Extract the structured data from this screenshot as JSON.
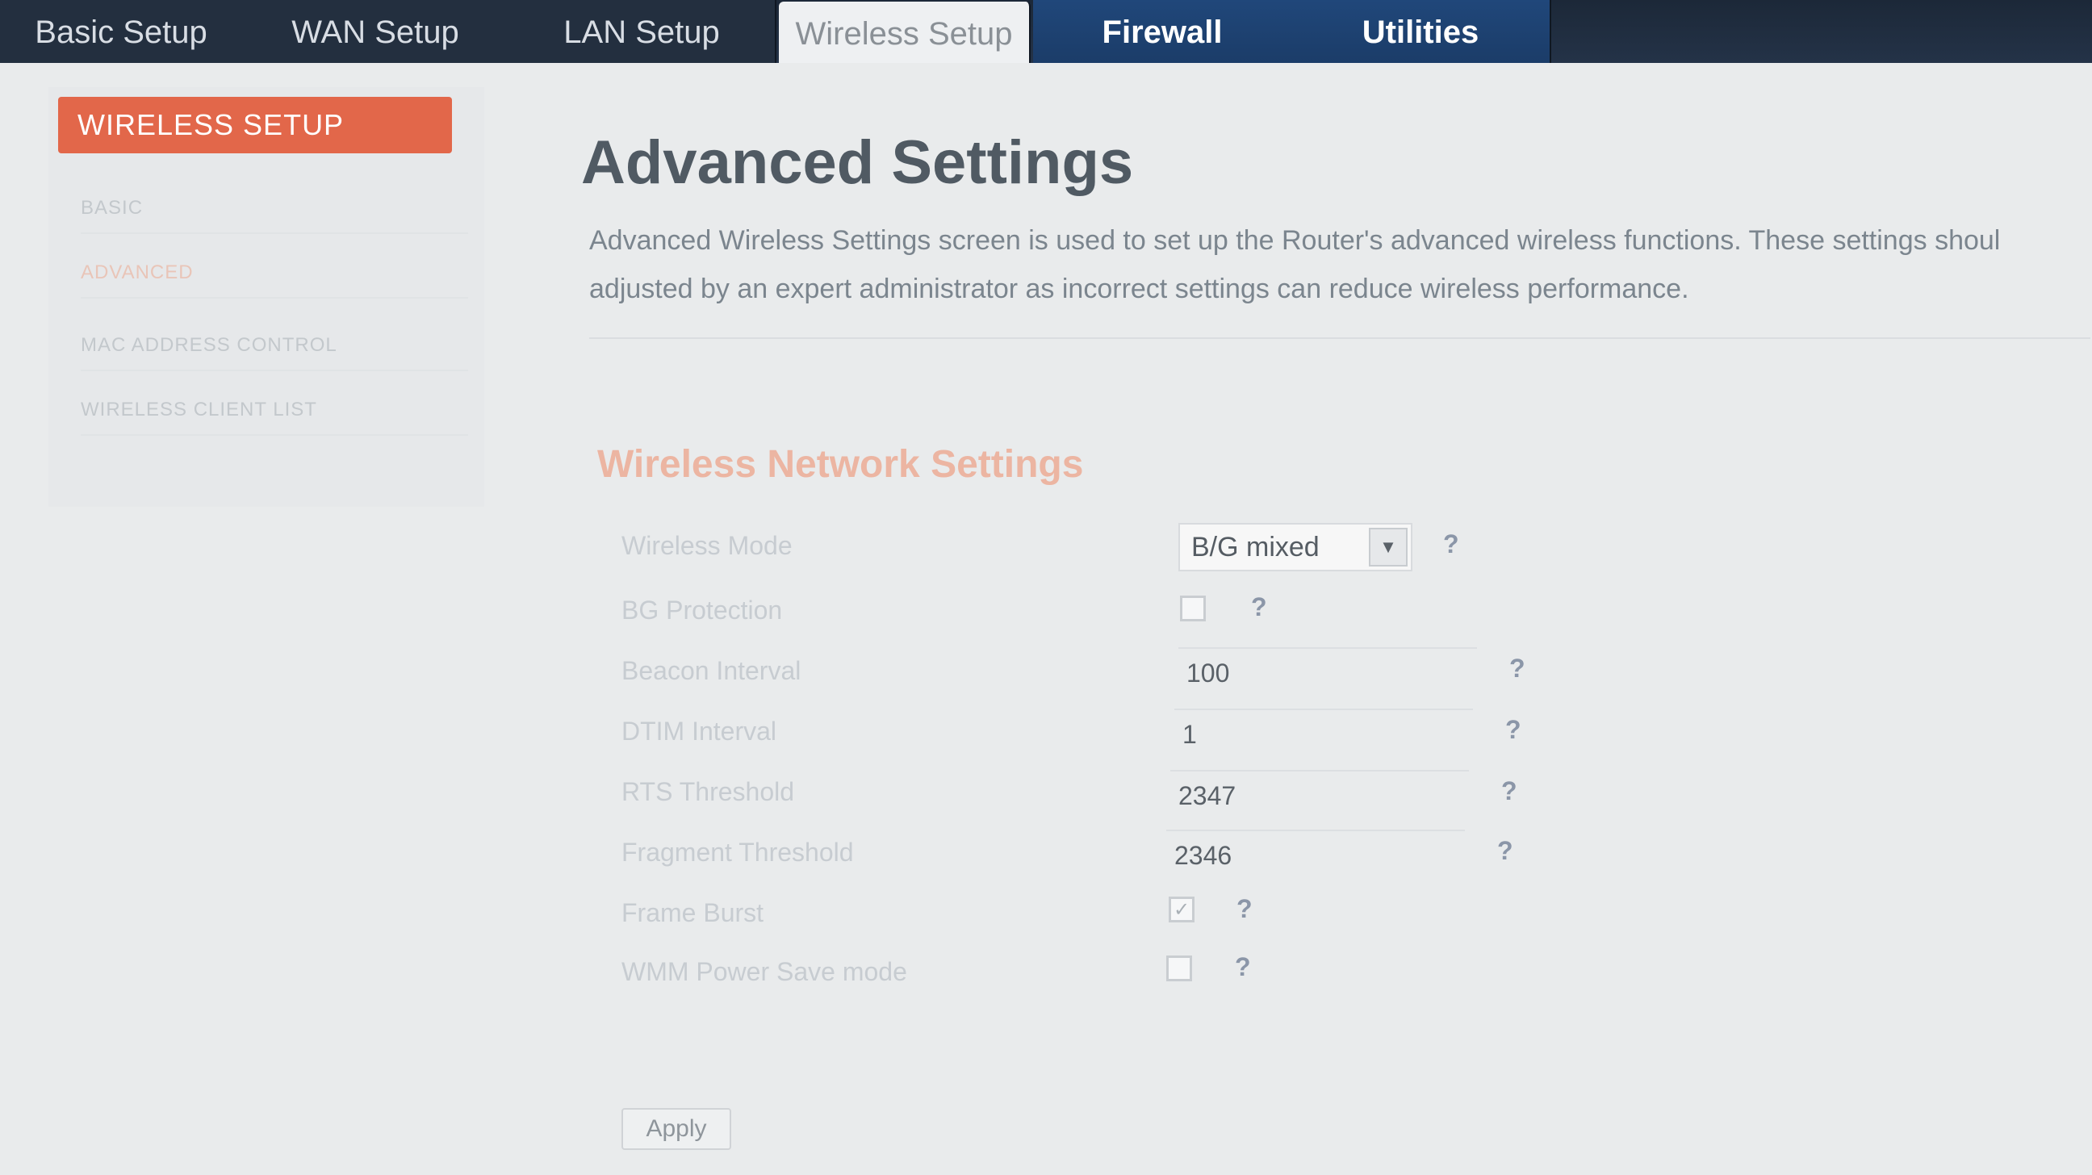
{
  "nav": {
    "tabs": [
      {
        "label": "Basic Setup"
      },
      {
        "label": "WAN Setup"
      },
      {
        "label": "LAN Setup"
      },
      {
        "label": "Wireless Setup"
      },
      {
        "label": "Firewall"
      },
      {
        "label": "Utilities"
      }
    ],
    "active_tab": "Wireless Setup"
  },
  "sidebar": {
    "header": "WIRELESS SETUP",
    "items": [
      {
        "label": "BASIC"
      },
      {
        "label": "ADVANCED"
      },
      {
        "label": "MAC ADDRESS CONTROL"
      },
      {
        "label": "WIRELESS CLIENT LIST"
      }
    ]
  },
  "main": {
    "title": "Advanced Settings",
    "description": "Advanced Wireless Settings screen is used to set up the Router's advanced wireless functions. These settings shoul adjusted by an expert administrator as incorrect settings can reduce wireless performance.",
    "section_title": "Wireless Network Settings"
  },
  "form": {
    "wireless_mode": {
      "label": "Wireless Mode",
      "value": "B/G mixed"
    },
    "bg_protection": {
      "label": "BG Protection",
      "checked": false
    },
    "beacon_interval": {
      "label": "Beacon Interval",
      "value": "100"
    },
    "dtim_interval": {
      "label": "DTIM Interval",
      "value": "1"
    },
    "rts_threshold": {
      "label": "RTS Threshold",
      "value": "2347"
    },
    "fragment_threshold": {
      "label": "Fragment Threshold",
      "value": "2346"
    },
    "frame_burst": {
      "label": "Frame Burst",
      "checked": true
    },
    "wmm_power_save": {
      "label": "WMM Power Save mode",
      "checked": false
    },
    "help_glyph": "?",
    "check_glyph": "✓",
    "arrow_glyph": "▼",
    "apply_label": "Apply"
  },
  "colors": {
    "accent": "#e2674a",
    "section_title": "#ecb5a2",
    "active_tab_bg": "#eef0f2",
    "blue_tab_bg": "#1b3c68"
  }
}
